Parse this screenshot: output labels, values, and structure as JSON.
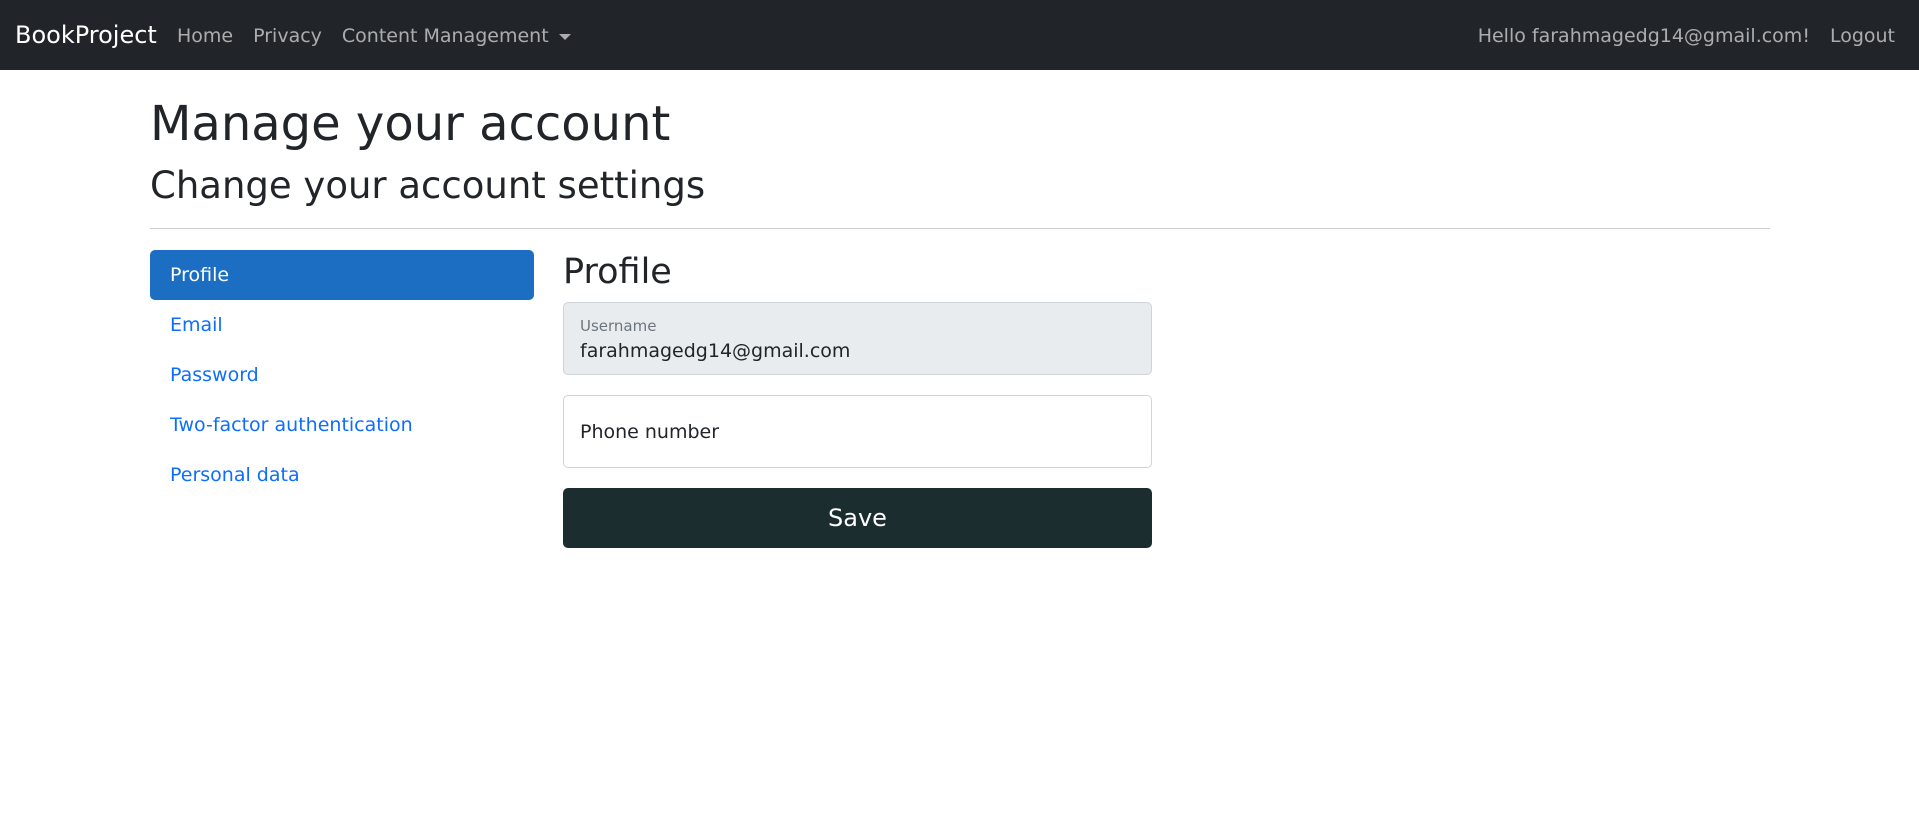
{
  "navbar": {
    "brand": "BookProject",
    "links": [
      "Home",
      "Privacy"
    ],
    "dropdown_label": "Content Management",
    "greeting": "Hello farahmagedg14@gmail.com!",
    "logout": "Logout"
  },
  "header": {
    "title": "Manage your account",
    "subtitle": "Change your account settings"
  },
  "sidebar": {
    "items": [
      {
        "label": "Profile",
        "active": true
      },
      {
        "label": "Email",
        "active": false
      },
      {
        "label": "Password",
        "active": false
      },
      {
        "label": "Two-factor authentication",
        "active": false
      },
      {
        "label": "Personal data",
        "active": false
      }
    ]
  },
  "form": {
    "title": "Profile",
    "username_label": "Username",
    "username_value": "farahmagedg14@gmail.com",
    "phone_placeholder": "Phone number",
    "save_label": "Save"
  },
  "colors": {
    "navbar_bg": "#212529",
    "accent": "#1b6ec2",
    "link": "#0d6efd",
    "save_button": "#1b2d2f"
  }
}
